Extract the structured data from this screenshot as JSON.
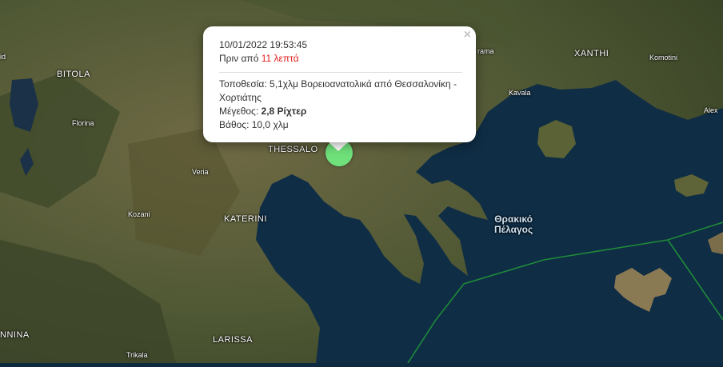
{
  "map": {
    "cities": {
      "bitola": "BITOLA",
      "florina": "Florina",
      "veria": "Veria",
      "kozani": "Kozani",
      "katerini": "KATERINI",
      "larissa": "LARISSA",
      "trikala": "Trikala",
      "ioannina": "NNINA",
      "thessaloniki": "THESSALO",
      "drama": "rama",
      "xanthi": "XANTHI",
      "komotini": "Komotini",
      "kavala": "Kavala",
      "alexandroupoli": "Alex",
      "edge_left": "id"
    },
    "sea": {
      "line1": "Θρακικό",
      "line2": "Πέλαγος"
    },
    "colors": {
      "marker": "#6fe07a",
      "boundary": "#1f8a3a",
      "accent_red": "#e0221e"
    }
  },
  "popup": {
    "datetime": "10/01/2022 19:53:45",
    "ago_prefix": "Πριν από",
    "ago_value": "11 λεπτά",
    "location_label": "Τοποθεσία:",
    "location_value": "5,1χλμ Βορειοανατολικά από Θεσσαλονίκη - Χορτιάτης",
    "magnitude_label": "Μέγεθος:",
    "magnitude_value": "2,8 Ρίχτερ",
    "depth_label": "Βάθος:",
    "depth_value": "10,0 χλμ",
    "close_glyph": "×"
  }
}
